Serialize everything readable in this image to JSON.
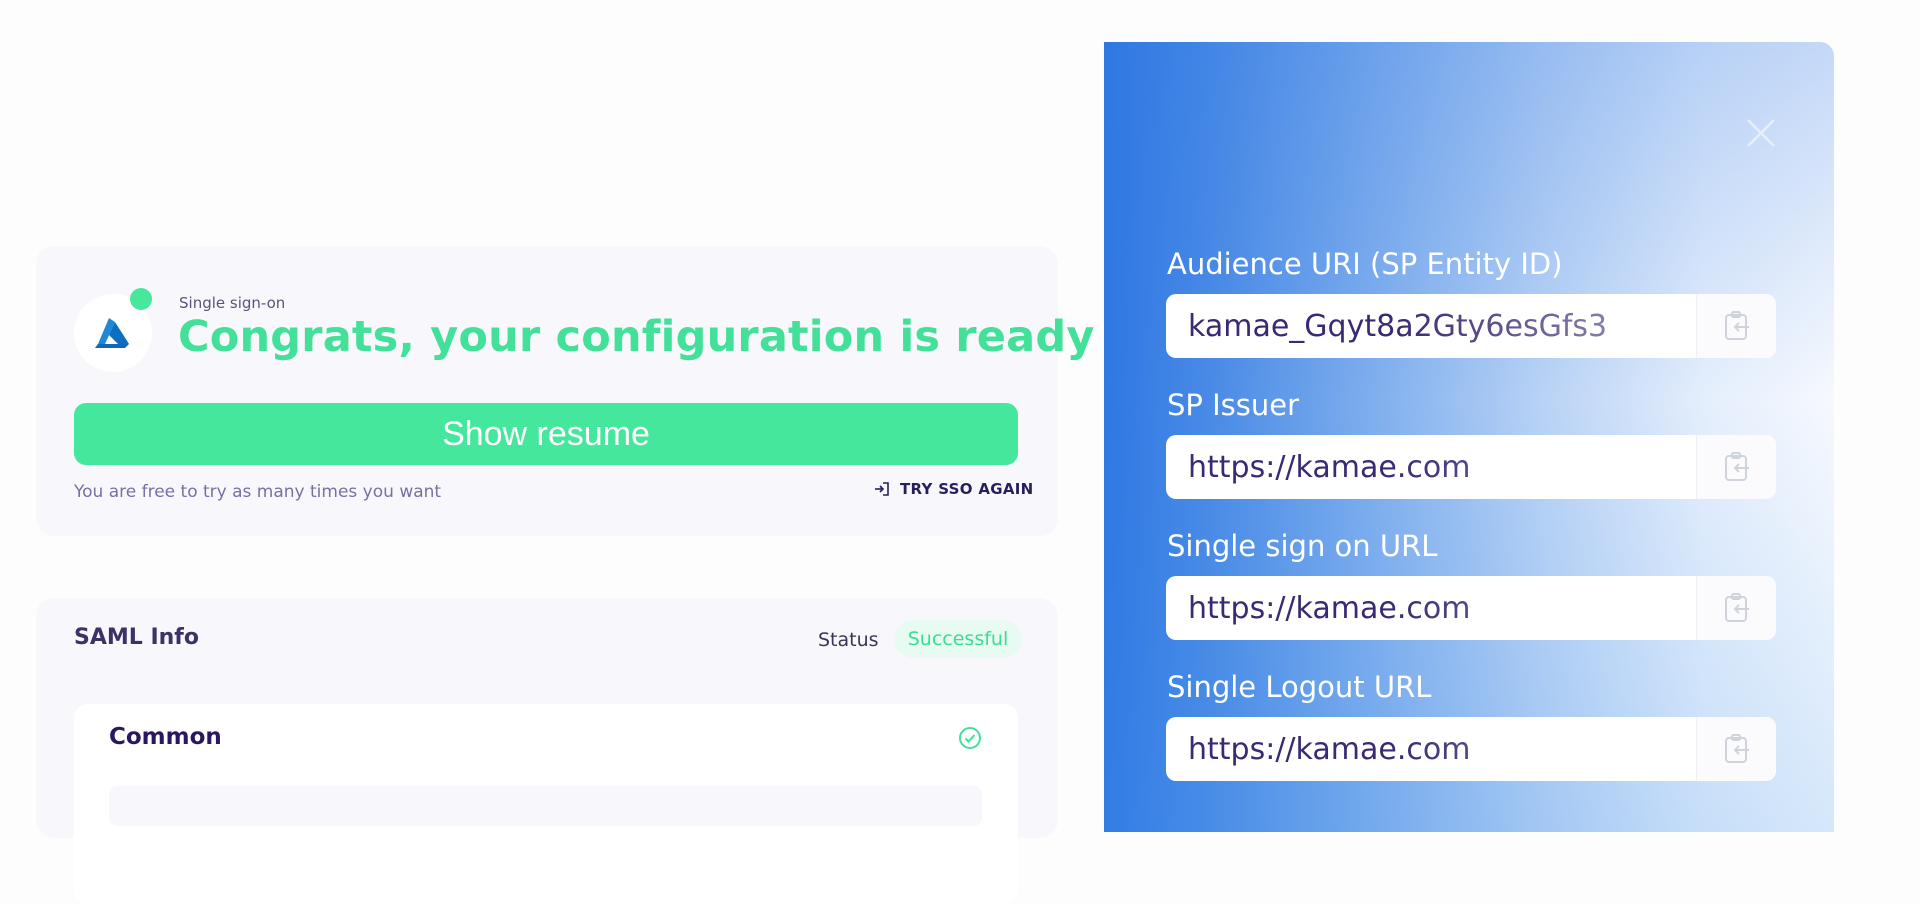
{
  "sso": {
    "eyebrow": "Single sign-on",
    "headline": "Congrats, your configuration is ready",
    "resume_button": "Show resume",
    "free_note": "You are free to try as many times you want",
    "try_again": "TRY SSO AGAIN",
    "provider_icon": "azure-logo-icon",
    "status_dot_color": "#47e89b"
  },
  "saml": {
    "title": "SAML Info",
    "status_label": "Status",
    "status_value": "Successful",
    "common_title": "Common"
  },
  "panel": {
    "fields": [
      {
        "label": "Audience URI (SP Entity ID)",
        "value": "kamae_Gqyt8a2Gty6esGfs3"
      },
      {
        "label": "SP Issuer",
        "value": "https://kamae.com"
      },
      {
        "label": "Single sign on URL",
        "value": "https://kamae.com"
      },
      {
        "label": "Single Logout URL",
        "value": "https://kamae.com"
      }
    ]
  },
  "colors": {
    "accent_green": "#45e79d",
    "panel_blue": "#2f77e3",
    "text_dark": "#2a1760"
  }
}
